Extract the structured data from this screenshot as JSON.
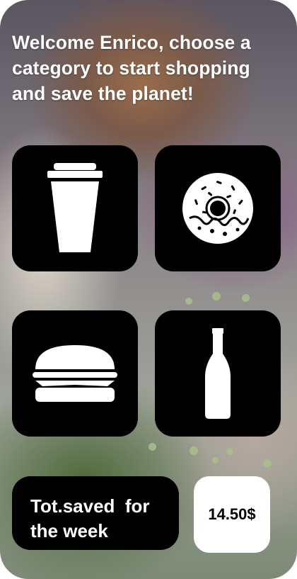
{
  "welcome": {
    "text": "Welcome Enrico, choose a category to start shopping and save the planet!"
  },
  "categories": [
    {
      "icon": "coffee-cup-icon"
    },
    {
      "icon": "donut-icon"
    },
    {
      "icon": "burger-icon"
    },
    {
      "icon": "bottle-icon"
    }
  ],
  "savings": {
    "label": "Tot.saved  for the week",
    "amount": "14.50$"
  },
  "colors": {
    "tile": "#000000",
    "text_light": "#ffffff",
    "amount_bg": "#ffffff"
  }
}
